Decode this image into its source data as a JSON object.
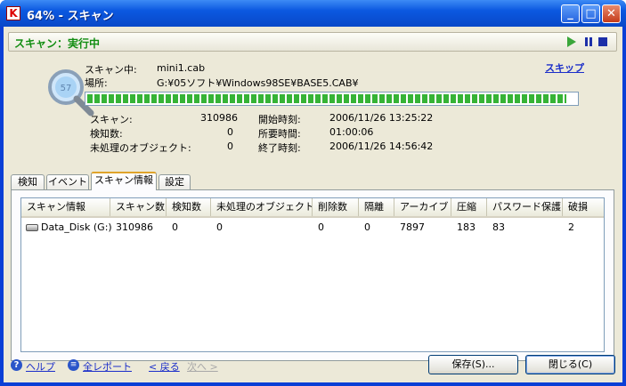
{
  "window": {
    "title": "64% - スキャン",
    "app_icon_letter": "K"
  },
  "status": {
    "label": "スキャン：実行中"
  },
  "scan": {
    "current_label": "スキャン中:",
    "current_value": "mini1.cab",
    "location_label": "場所:",
    "location_value": "G:¥05ソフト¥Windows98SE¥BASE5.CAB¥",
    "skip_label": "スキップ",
    "progress": 0.98,
    "icon_badge": "57"
  },
  "stats": {
    "scanned_label": "スキャン:",
    "scanned_value": "310986",
    "detected_label": "検知数:",
    "detected_value": "0",
    "untreated_label": "未処理のオブジェクト:",
    "untreated_value": "0",
    "start_label": "開始時刻:",
    "start_value": "2006/11/26 13:25:22",
    "elapsed_label": "所要時間:",
    "elapsed_value": "01:00:06",
    "end_label": "終了時刻:",
    "end_value": "2006/11/26 14:56:42"
  },
  "tabs": [
    "検知",
    "イベント",
    "スキャン情報",
    "設定"
  ],
  "table": {
    "columns": [
      "スキャン情報",
      "スキャン数",
      "検知数",
      "未処理のオブジェクト",
      "削除数",
      "隔離",
      "アーカイブ",
      "圧縮",
      "パスワード保護",
      "破損"
    ],
    "rows": [
      [
        "Data_Disk (G:)",
        "310986",
        "0",
        "0",
        "0",
        "0",
        "7897",
        "183",
        "83",
        "2"
      ]
    ]
  },
  "footer": {
    "help": "ヘルプ",
    "full_report": "全レポート",
    "back": "< 戻る",
    "next": "次へ >",
    "save": "保存(S)...",
    "close": "閉じる(C)"
  },
  "colors": {
    "status_green": "#118d11",
    "link_blue": "#1b2ec9",
    "progress_green": "#36b336"
  }
}
